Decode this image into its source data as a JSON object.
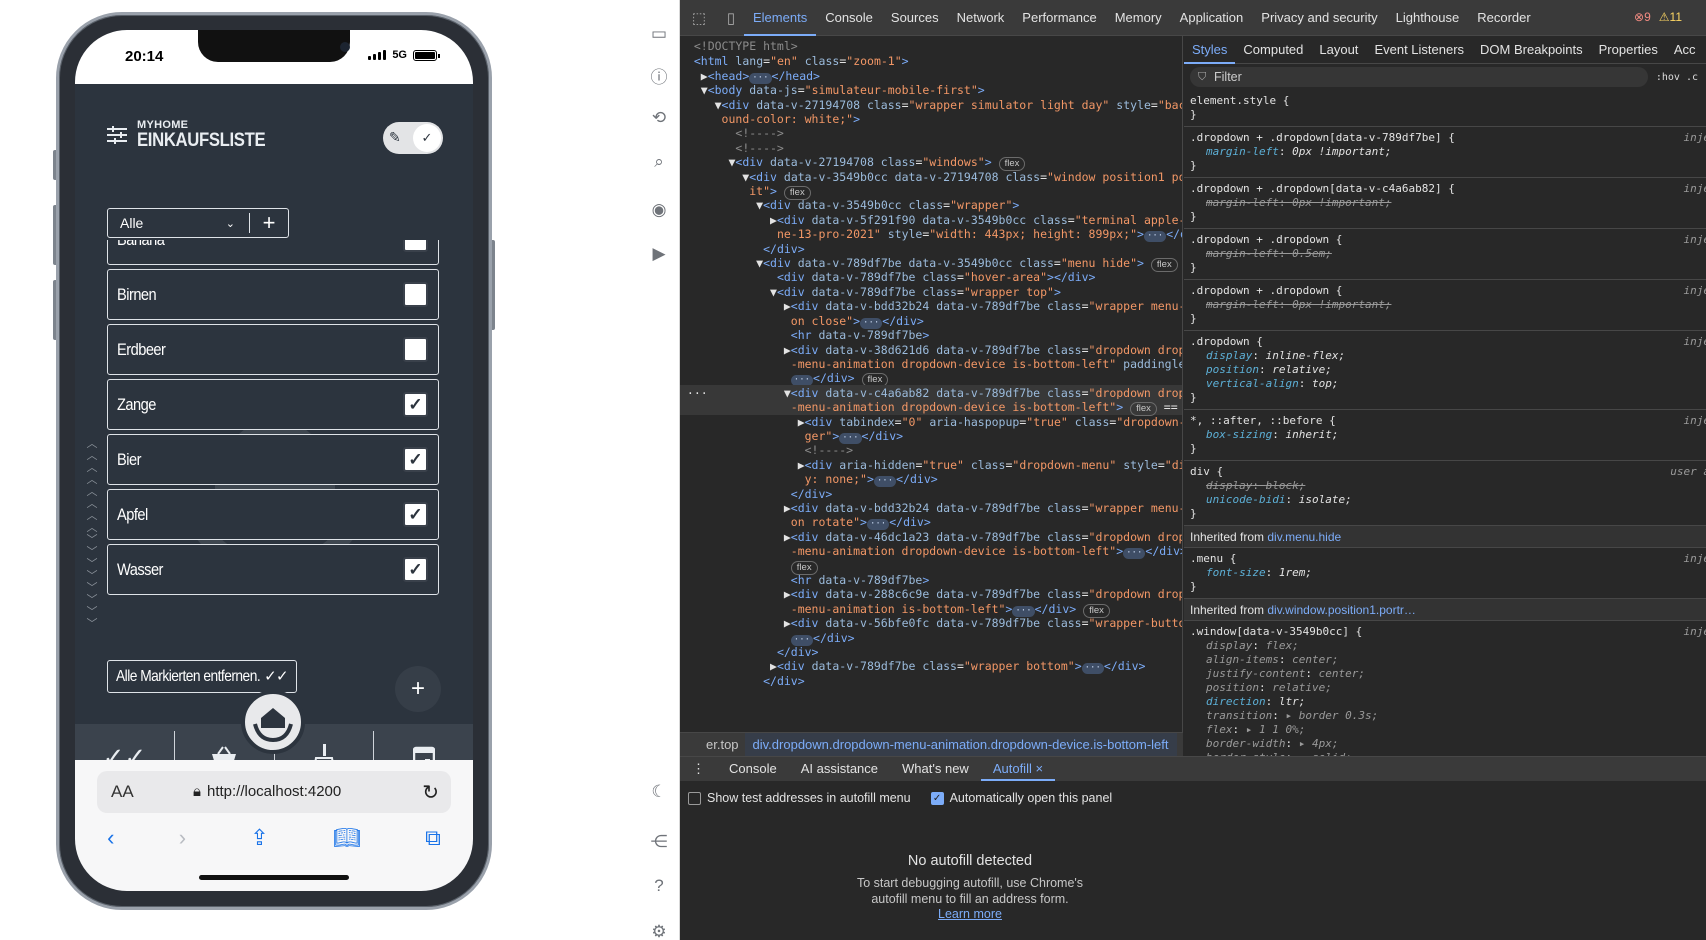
{
  "phone": {
    "time": "20:14",
    "network": "5G",
    "app": {
      "brand_top": "MYHOME",
      "brand_main": "EINKAUFSLISTE",
      "filter_value": "Alle",
      "items": [
        {
          "label": "Banana",
          "checked": false
        },
        {
          "label": "Birnen",
          "checked": false
        },
        {
          "label": "Erdbeer",
          "checked": false
        },
        {
          "label": "Zange",
          "checked": true
        },
        {
          "label": "Bier",
          "checked": true
        },
        {
          "label": "Apfel",
          "checked": true
        },
        {
          "label": "Wasser",
          "checked": true
        }
      ],
      "remove_button": "Alle Markierten entfernen.",
      "fab": "+"
    },
    "safari": {
      "aa": "AA",
      "url": "http://localhost:4200"
    }
  },
  "devtools": {
    "tabs": [
      "Elements",
      "Console",
      "Sources",
      "Network",
      "Performance",
      "Memory",
      "Application",
      "Privacy and security",
      "Lighthouse",
      "Recorder"
    ],
    "errors": "9",
    "warnings": "11",
    "breadcrumb": {
      "prev": "er.top",
      "current": "div.dropdown.dropdown-menu-animation.dropdown-device.is-bottom-left"
    },
    "styles_tabs": [
      "Styles",
      "Computed",
      "Layout",
      "Event Listeners",
      "DOM Breakpoints",
      "Properties",
      "Acc"
    ],
    "filter_placeholder": "Filter",
    "hov": ":hov  .c",
    "inherited": [
      {
        "label": "Inherited from ",
        "link": "div.menu.hide"
      },
      {
        "label": "Inherited from ",
        "link": "div.window.position1.portr…"
      }
    ],
    "drawer_tabs": [
      "Console",
      "AI assistance",
      "What's new",
      "Autofill"
    ],
    "checkbox_1": "Show test addresses in autofill menu",
    "checkbox_2": "Automatically open this panel",
    "no_autofill_title": "No autofill detected",
    "no_autofill_text_1": "To start debugging autofill, use Chrome's",
    "no_autofill_text_2": "autofill menu to fill an address form.",
    "learn_more": "Learn more"
  }
}
